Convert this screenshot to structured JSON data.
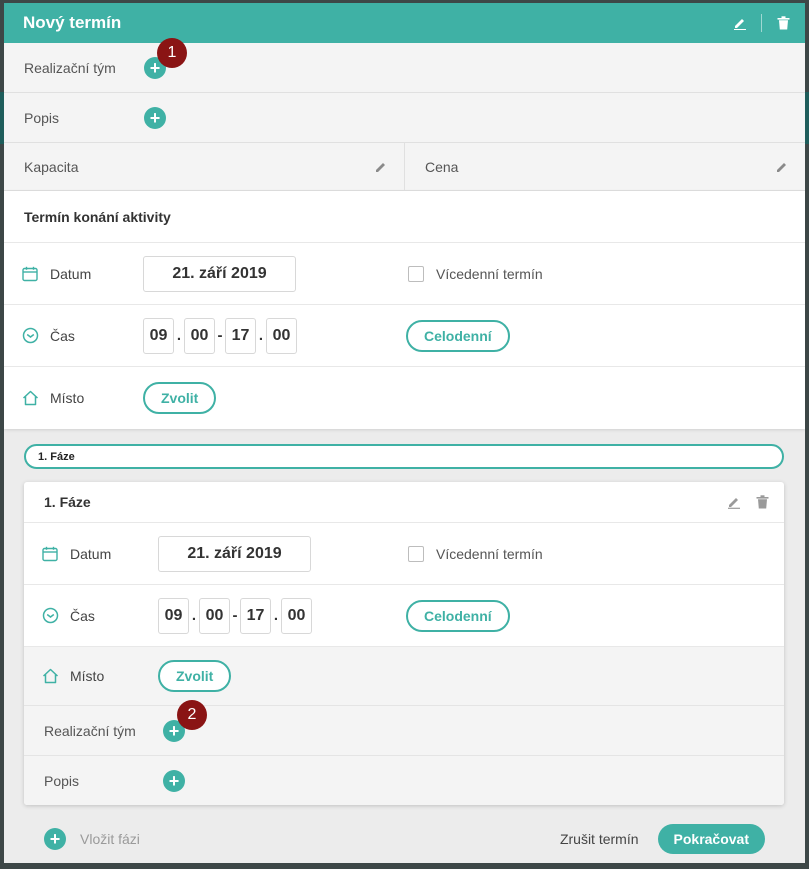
{
  "header": {
    "title": "Nový termín"
  },
  "top_rows": {
    "team_label": "Realizační tým",
    "description_label": "Popis",
    "capacity_label": "Kapacita",
    "price_label": "Cena"
  },
  "badges": {
    "first": "1",
    "second": "2"
  },
  "activity": {
    "section_title": "Termín konání aktivity",
    "date_label": "Datum",
    "date_value": "21. září 2019",
    "multiday_label": "Vícedenní termín",
    "time_label": "Čas",
    "time": {
      "start_h": "09",
      "start_m": "00",
      "end_h": "17",
      "end_m": "00",
      "dot": ".",
      "dash": "-"
    },
    "allday_label": "Celodenní",
    "place_label": "Místo",
    "place_button": "Zvolit"
  },
  "phase_tab": {
    "label": "1. Fáze"
  },
  "phase": {
    "title": "1. Fáze",
    "date_label": "Datum",
    "date_value": "21. září 2019",
    "multiday_label": "Vícedenní termín",
    "time_label": "Čas",
    "time": {
      "start_h": "09",
      "start_m": "00",
      "end_h": "17",
      "end_m": "00",
      "dot": ".",
      "dash": "-"
    },
    "allday_label": "Celodenní",
    "place_label": "Místo",
    "place_button": "Zvolit",
    "team_label": "Realizační tým",
    "description_label": "Popis"
  },
  "footer": {
    "insert_label": "Vložit fázi",
    "cancel_label": "Zrušit termín",
    "continue_label": "Pokračovat"
  },
  "colors": {
    "accent": "#3fb1a5",
    "badge": "#8a1414"
  },
  "icons": {
    "plus": "+",
    "header": [
      "pencil-icon",
      "trash-icon"
    ],
    "fields": [
      "calendar-icon",
      "clock-icon",
      "home-icon"
    ]
  }
}
